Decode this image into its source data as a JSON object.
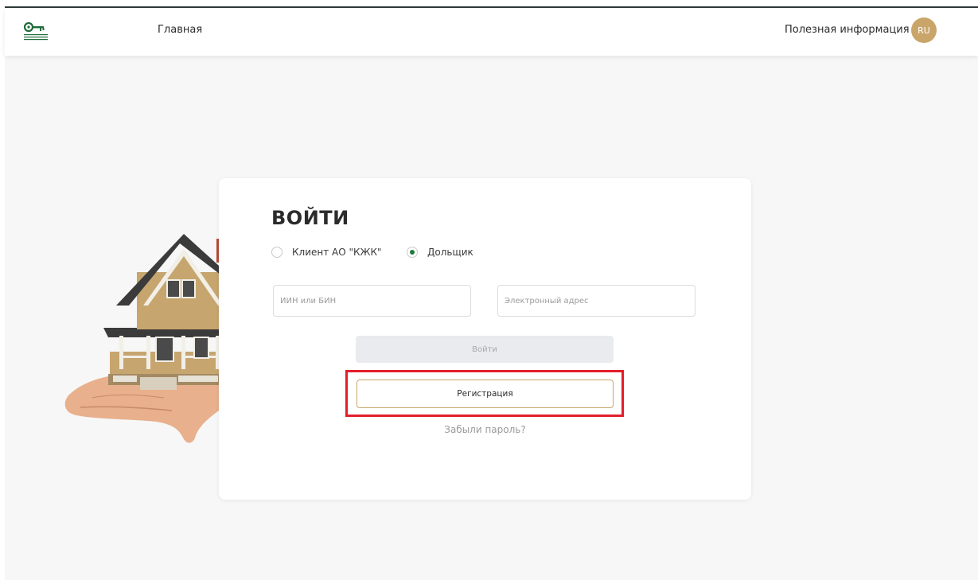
{
  "header": {
    "nav_home": "Главная",
    "nav_info": "Полезная информация",
    "language": "RU"
  },
  "login": {
    "title": "ВОЙТИ",
    "radio_options": [
      {
        "label": "Клиент АО \"КЖК\"",
        "selected": false
      },
      {
        "label": "Дольщик",
        "selected": true
      }
    ],
    "iin_placeholder": "ИИН или БИН",
    "email_placeholder": "Электронный адрес",
    "login_button": "Войти",
    "register_button": "Регистрация",
    "forgot_link": "Забыли пароль?"
  },
  "colors": {
    "accent_gold": "#c9a56a",
    "radio_green": "#1e7a3b",
    "highlight_red": "#e41e2b",
    "background": "#f7f7f7"
  }
}
